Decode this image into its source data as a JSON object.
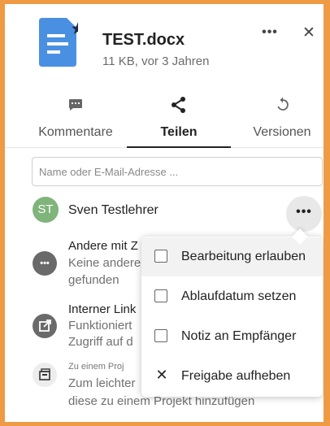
{
  "file": {
    "name": "TEST.docx",
    "meta": "11 KB, vor 3 Jahren",
    "icon": "document-starred-icon",
    "icon_color": "#4a90e2"
  },
  "header": {
    "more_label": "•••",
    "close_label": "✕"
  },
  "tabs": [
    {
      "label": "Kommentare",
      "icon": "comment-icon",
      "active": false
    },
    {
      "label": "Teilen",
      "icon": "share-icon",
      "active": true
    },
    {
      "label": "Versionen",
      "icon": "restore-icon",
      "active": false
    }
  ],
  "search": {
    "placeholder": "Name oder E-Mail-Adresse ..."
  },
  "shares": [
    {
      "initials": "ST",
      "name": "Sven Testlehrer",
      "avatar_color": "#7fb47b",
      "more_label": "•••"
    }
  ],
  "sections": {
    "other": {
      "title": "Andere mit Z",
      "line1": "Keine andere",
      "line2": "gefunden",
      "icon_label": "•••"
    },
    "internal": {
      "title": "Interner Link",
      "line1": "Funktioniert",
      "line2": "Zugriff auf d"
    },
    "project": {
      "small": "Zu einem Proj",
      "line1": "Zum leichter",
      "line2": "diese zu einem Projekt hinzufügen"
    }
  },
  "menu": {
    "items": [
      {
        "label": "Bearbeitung erlauben",
        "type": "checkbox",
        "checked": false
      },
      {
        "label": "Ablaufdatum setzen",
        "type": "checkbox",
        "checked": false
      },
      {
        "label": "Notiz an Empfänger",
        "type": "checkbox",
        "checked": false
      },
      {
        "label": "Freigabe aufheben",
        "type": "action",
        "icon": "close-icon"
      }
    ]
  },
  "colors": {
    "frame": "#ef9a44",
    "active_tab": "#222222"
  }
}
